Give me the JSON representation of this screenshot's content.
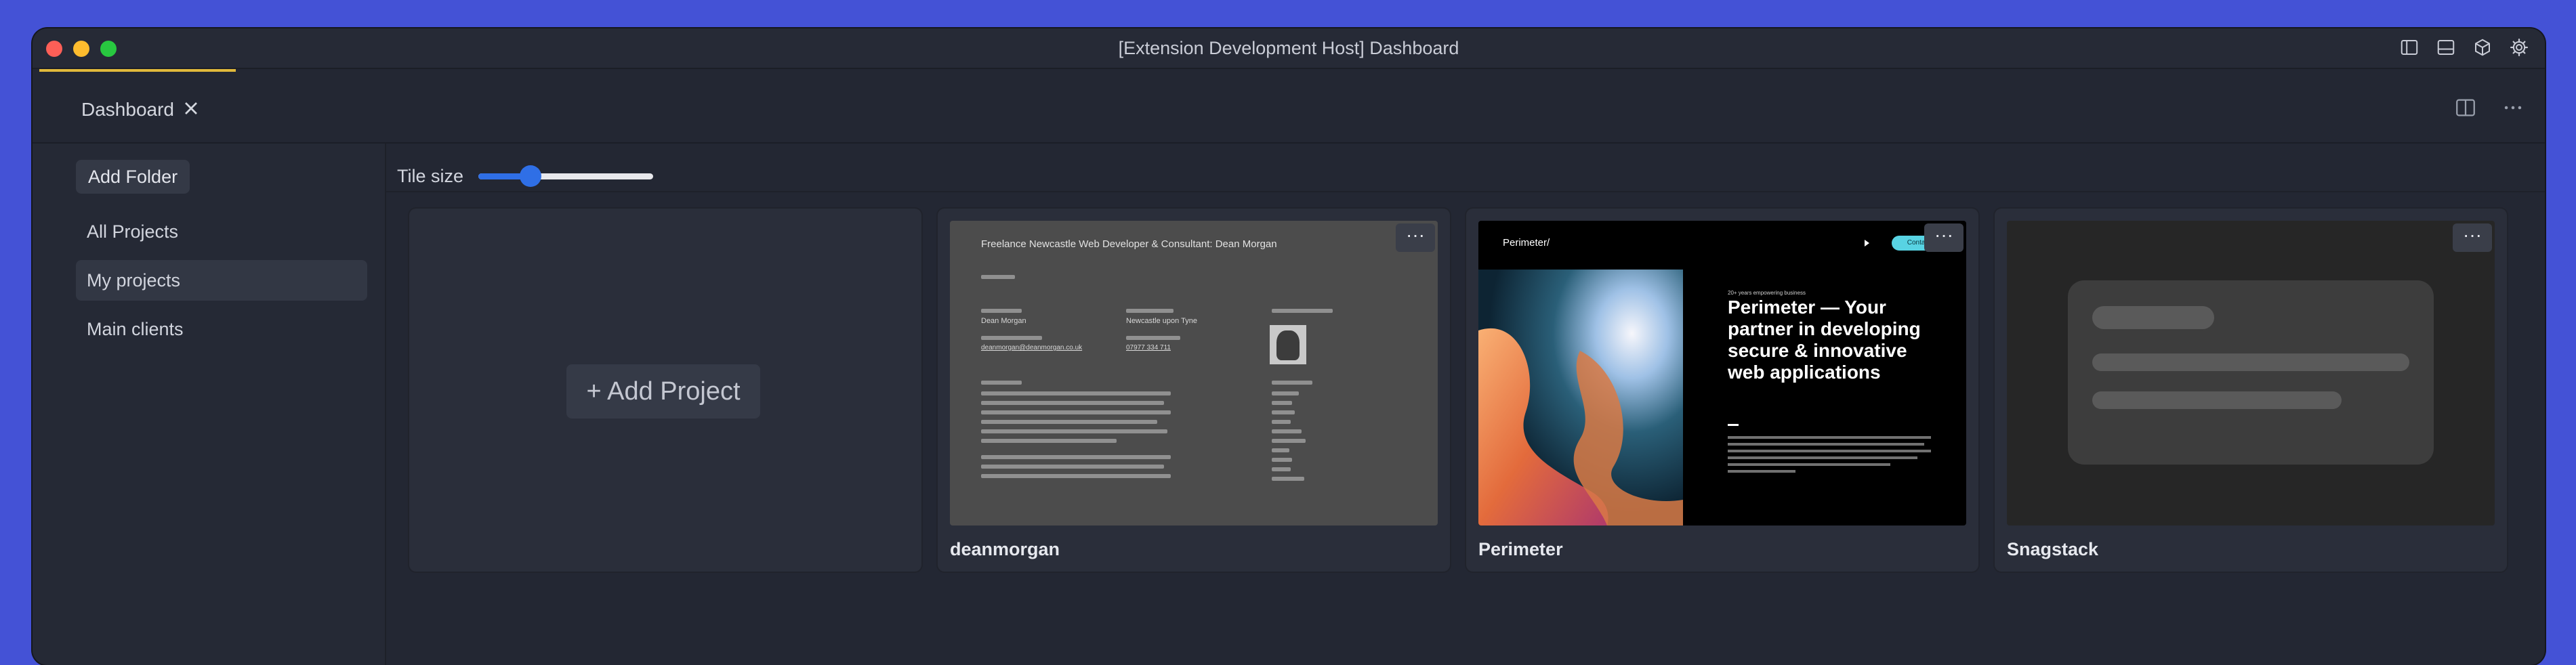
{
  "window": {
    "title": "[Extension Development Host] Dashboard",
    "titlebar_icons": [
      "sidebar-toggle-icon",
      "panel-toggle-icon",
      "extensions-cube-icon",
      "gear-icon"
    ]
  },
  "tabs": [
    {
      "label": "Dashboard",
      "active": true
    }
  ],
  "tabbar_actions": [
    "split-editor-icon",
    "more-actions-icon"
  ],
  "sidebar": {
    "add_folder_label": "Add Folder",
    "items": [
      {
        "label": "All Projects",
        "active": false
      },
      {
        "label": "My projects",
        "active": true
      },
      {
        "label": "Main clients",
        "active": false
      }
    ]
  },
  "toolbar": {
    "tile_size_label": "Tile size",
    "tile_size_value": 0.3
  },
  "add_project_label": "+ Add Project",
  "projects": [
    {
      "name": "deanmorgan",
      "menu": "···",
      "preview": {
        "heading": "Freelance Newcastle Web Developer & Consultant: Dean Morgan",
        "name_text": "Dean Morgan",
        "location_text": "Newcastle upon Tyne",
        "email_text": "deanmorgan@deanmorgan.co.uk",
        "phone_text": "07977 334 711"
      }
    },
    {
      "name": "Perimeter",
      "menu": "···",
      "preview": {
        "logo": "Perimeter/",
        "contact": "Contact",
        "tagline": "20+ years empowering business",
        "headline": "Perimeter — Your partner in developing secure & innovative web applications"
      }
    },
    {
      "name": "Snagstack",
      "menu": "···"
    }
  ]
}
